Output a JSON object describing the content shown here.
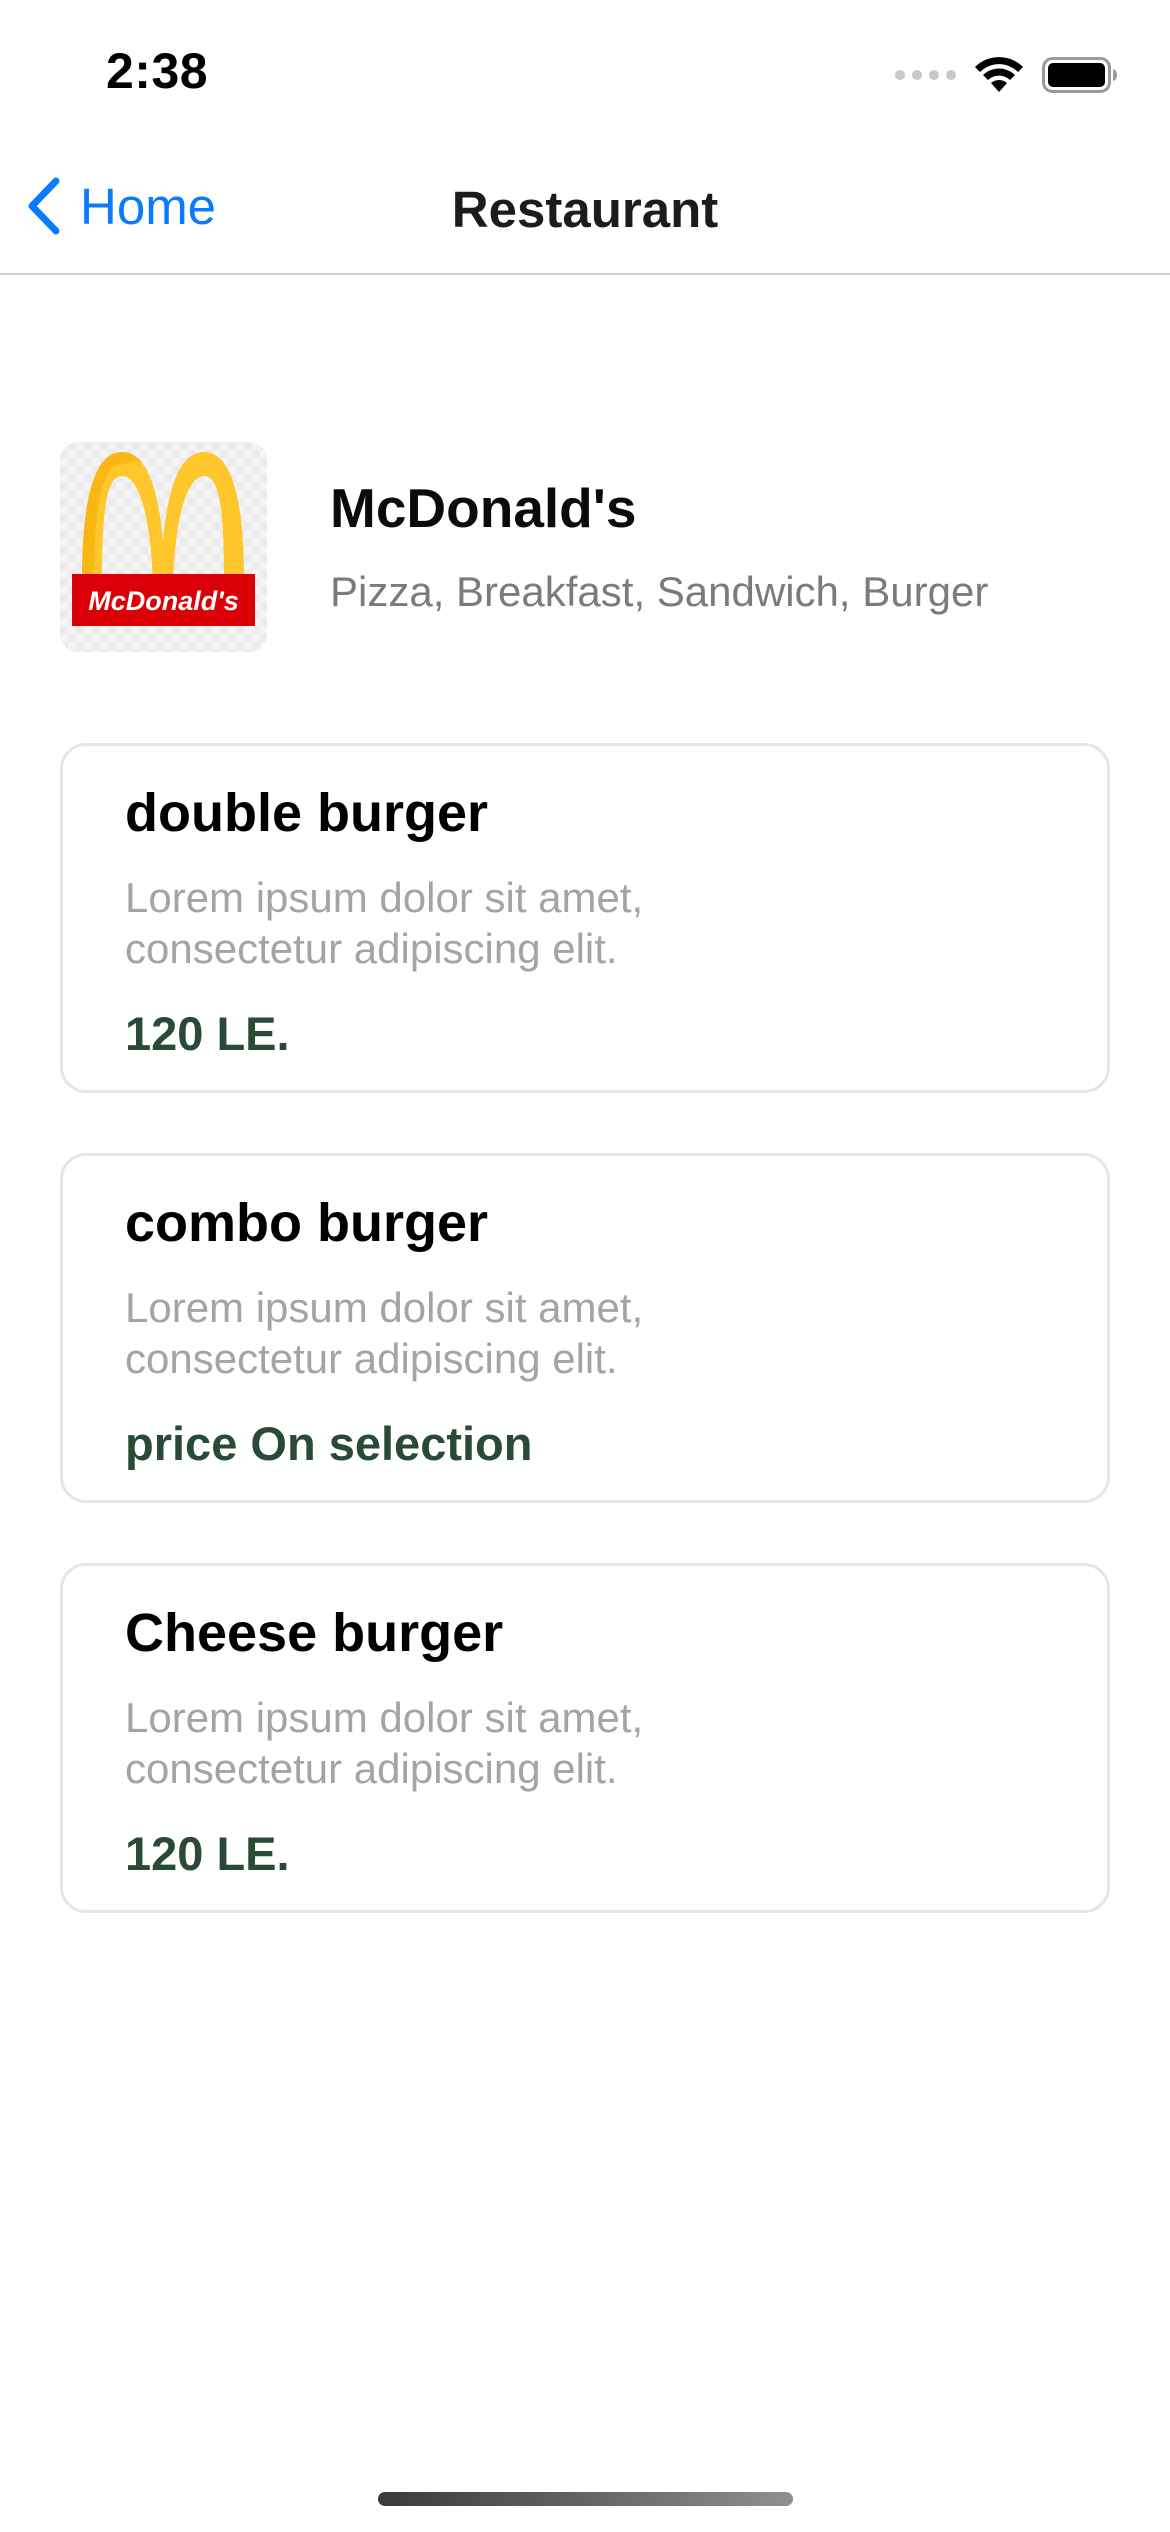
{
  "status_bar": {
    "time": "2:38",
    "signal_icon": "signal-dots-icon",
    "wifi_icon": "wifi-icon",
    "battery_icon": "battery-icon"
  },
  "nav": {
    "back_label": "Home",
    "back_icon": "chevron-left-icon",
    "title": "Restaurant",
    "accent_color": "#0a7aff"
  },
  "restaurant": {
    "name": "McDonald's",
    "categories": "Pizza, Breakfast, Sandwich, Burger",
    "logo_text": "McDonald's"
  },
  "menu_items": [
    {
      "title": "double burger",
      "description": "Lorem ipsum dolor sit amet, consectetur adipiscing elit.",
      "price": "120 LE."
    },
    {
      "title": "combo burger",
      "description": "Lorem ipsum dolor sit amet, consectetur adipiscing elit.",
      "price": "price On selection"
    },
    {
      "title": "Cheese burger",
      "description": "Lorem ipsum dolor sit amet, consectetur adipiscing elit.",
      "price": "120 LE."
    }
  ],
  "colors": {
    "price": "#2a4a38",
    "description": "#a4a4a8",
    "card_border": "#e6e6e8"
  }
}
